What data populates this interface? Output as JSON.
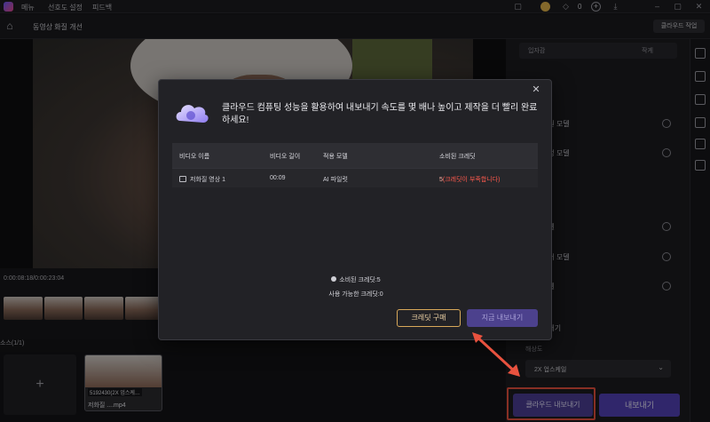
{
  "topbar": {
    "menu": [
      "메뉴",
      "선호도 설정",
      "피드백"
    ],
    "credit_count": "0"
  },
  "subbar": {
    "title": "동영상 화질 개선",
    "cloud_task_label": "클라우드 작업"
  },
  "timeline": {
    "time": "0:00:08:18/0:00:23:04",
    "source_label": "소스(1/1)"
  },
  "media_bin": {
    "add_label": "+",
    "clip_badge": "5192430(2X 업스케…",
    "clip_name": "저화질 ....mp4"
  },
  "right_panel": {
    "seg_left": "입자감",
    "seg_right": "작게",
    "heading_1": "모델",
    "option_1": "복원 모델",
    "option_2": "생성 모델",
    "heading_2": "모델",
    "option_3": "모델",
    "option_4": "제거 모델",
    "option_5": "모델",
    "export_heading": "보내기",
    "resolution_label": "해상도",
    "resolution_value": "2X 업스케일",
    "cloud_export_label": "클라우드 내보내기",
    "export_label": "내보내기"
  },
  "dialog": {
    "title": "클라우드 컴퓨팅 성능을 활용하여 내보내기 속도를 몇 배나 높이고 제작을 더 빨리 완료하세요!",
    "columns": [
      "비디오 이름",
      "비디오 길이",
      "적용 모델",
      "소비된 크레딧"
    ],
    "rows": [
      {
        "name": "저화질 영상 1",
        "length": "00:09",
        "model": "AI 파일럿",
        "credit": "5",
        "credit_note": "(크레딧이 부족합니다)"
      }
    ],
    "consumed_credits": "소비된 크레딧:5",
    "available_credits": "사용 가능한 크레딧:0",
    "buy_label": "크레딧 구매",
    "export_now_label": "지금 내보내기"
  },
  "colors": {
    "accent": "#5442b8",
    "warning": "#ff5a4d",
    "highlight": "#e8523f"
  }
}
